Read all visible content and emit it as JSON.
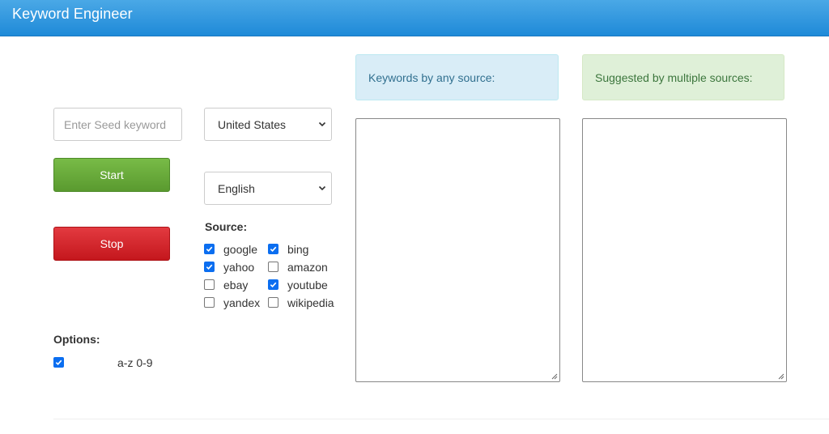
{
  "header": {
    "brand": "Keyword Engineer"
  },
  "seed": {
    "placeholder": "Enter Seed keyword",
    "value": ""
  },
  "buttons": {
    "start": "Start",
    "stop": "Stop"
  },
  "country": {
    "selected": "United States"
  },
  "language": {
    "selected": "English"
  },
  "source": {
    "label": "Source:",
    "items": [
      {
        "name": "google",
        "checked": true
      },
      {
        "name": "bing",
        "checked": true
      },
      {
        "name": "yahoo",
        "checked": true
      },
      {
        "name": "amazon",
        "checked": false
      },
      {
        "name": "ebay",
        "checked": false
      },
      {
        "name": "youtube",
        "checked": true
      },
      {
        "name": "yandex",
        "checked": false
      },
      {
        "name": "wikipedia",
        "checked": false
      }
    ]
  },
  "options": {
    "label": "Options:",
    "items": [
      {
        "name": "a-z 0-9",
        "checked": true
      }
    ]
  },
  "panels": {
    "any_source": "Keywords by any source:",
    "multiple_sources": "Suggested by multiple sources:"
  },
  "colors": {
    "navbar": "#1f8ad8",
    "start": "#5fa035",
    "stop": "#d0212a",
    "checkbox": "#0b6ef0",
    "info_panel": "#d9edf7",
    "success_panel": "#dff0d8"
  }
}
